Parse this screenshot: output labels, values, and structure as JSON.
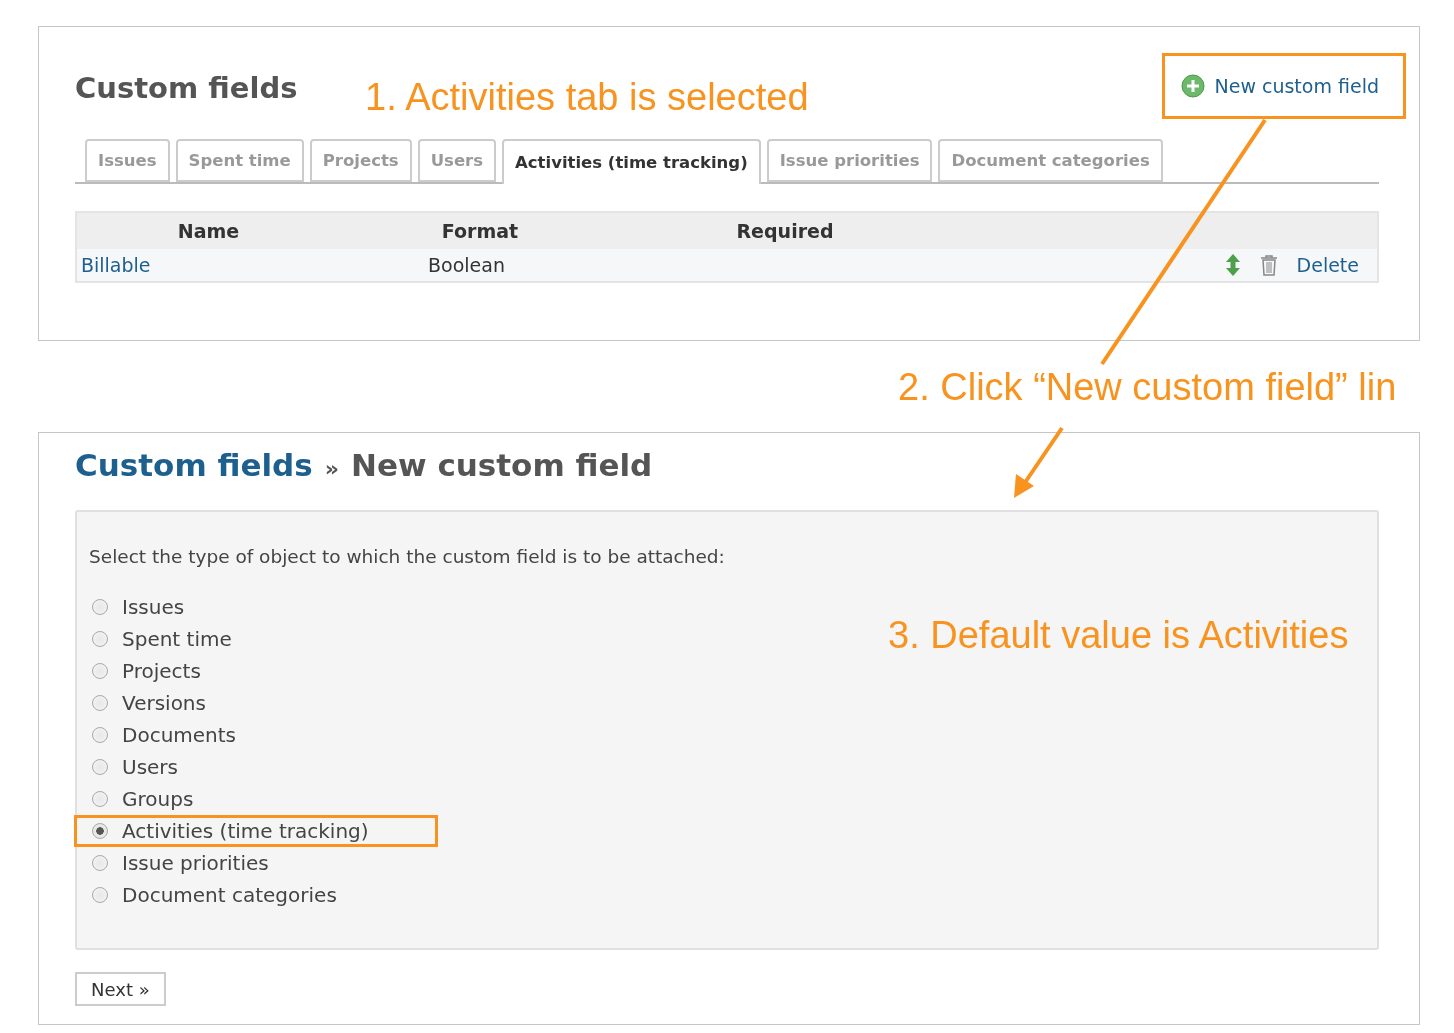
{
  "first_screen": {
    "title": "Custom fields",
    "new_link": {
      "label": "New custom field",
      "highlighted": true
    },
    "tabs": [
      {
        "label": "Issues",
        "selected": false
      },
      {
        "label": "Spent time",
        "selected": false
      },
      {
        "label": "Projects",
        "selected": false
      },
      {
        "label": "Users",
        "selected": false
      },
      {
        "label": "Activities (time tracking)",
        "selected": true
      },
      {
        "label": "Issue priorities",
        "selected": false
      },
      {
        "label": "Document categories",
        "selected": false
      }
    ],
    "table": {
      "columns": [
        "Name",
        "Format",
        "Required"
      ],
      "rows": [
        {
          "name": "Billable",
          "format": "Boolean",
          "delete": "Delete"
        }
      ]
    }
  },
  "second_screen": {
    "breadcrumb_link": "Custom fields",
    "separator": "»",
    "current": "New custom field",
    "prompt": "Select the type of object to which the custom field is to be attached:",
    "options": [
      {
        "label": "Issues",
        "selected": false,
        "highlighted": false
      },
      {
        "label": "Spent time",
        "selected": false,
        "highlighted": false
      },
      {
        "label": "Projects",
        "selected": false,
        "highlighted": false
      },
      {
        "label": "Versions",
        "selected": false,
        "highlighted": false
      },
      {
        "label": "Documents",
        "selected": false,
        "highlighted": false
      },
      {
        "label": "Users",
        "selected": false,
        "highlighted": false
      },
      {
        "label": "Groups",
        "selected": false,
        "highlighted": false
      },
      {
        "label": "Activities (time tracking)",
        "selected": true,
        "highlighted": true
      },
      {
        "label": "Issue priorities",
        "selected": false,
        "highlighted": false
      },
      {
        "label": "Document categories",
        "selected": false,
        "highlighted": false
      }
    ],
    "next_button": "Next »"
  },
  "annotations": [
    {
      "text": "1. Activities tab is selected"
    },
    {
      "text": "2. Click “New custom field” lin"
    },
    {
      "text": "3. Default value is Activities"
    }
  ]
}
